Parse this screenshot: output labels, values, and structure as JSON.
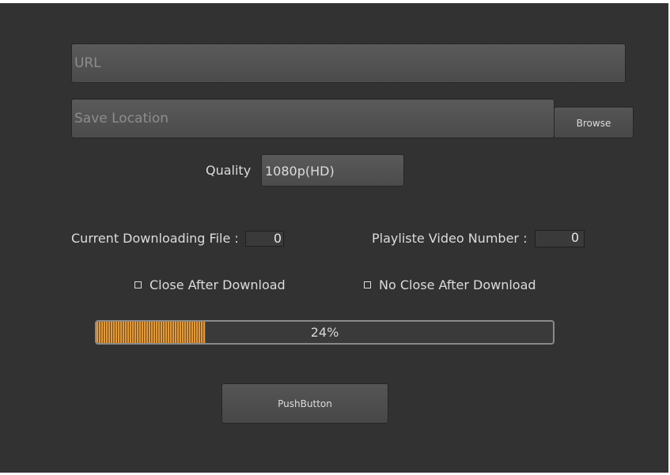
{
  "url_field": {
    "placeholder": "URL"
  },
  "save_location_field": {
    "placeholder": "Save Location"
  },
  "browse_button": {
    "label": "Browse"
  },
  "quality": {
    "label": "Quality",
    "selected": "1080p(HD)"
  },
  "current_file": {
    "label": "Current Downloading File :",
    "value": "0"
  },
  "playlist_video": {
    "label": "Playliste Video Number :",
    "value": "0"
  },
  "close_after": {
    "label": "Close After Download",
    "checked": false
  },
  "no_close_after": {
    "label": "No Close After Download",
    "checked": false
  },
  "progress": {
    "value": 24,
    "text": "24%",
    "color": "#e09a3d"
  },
  "push_button": {
    "label": "PushButton"
  }
}
